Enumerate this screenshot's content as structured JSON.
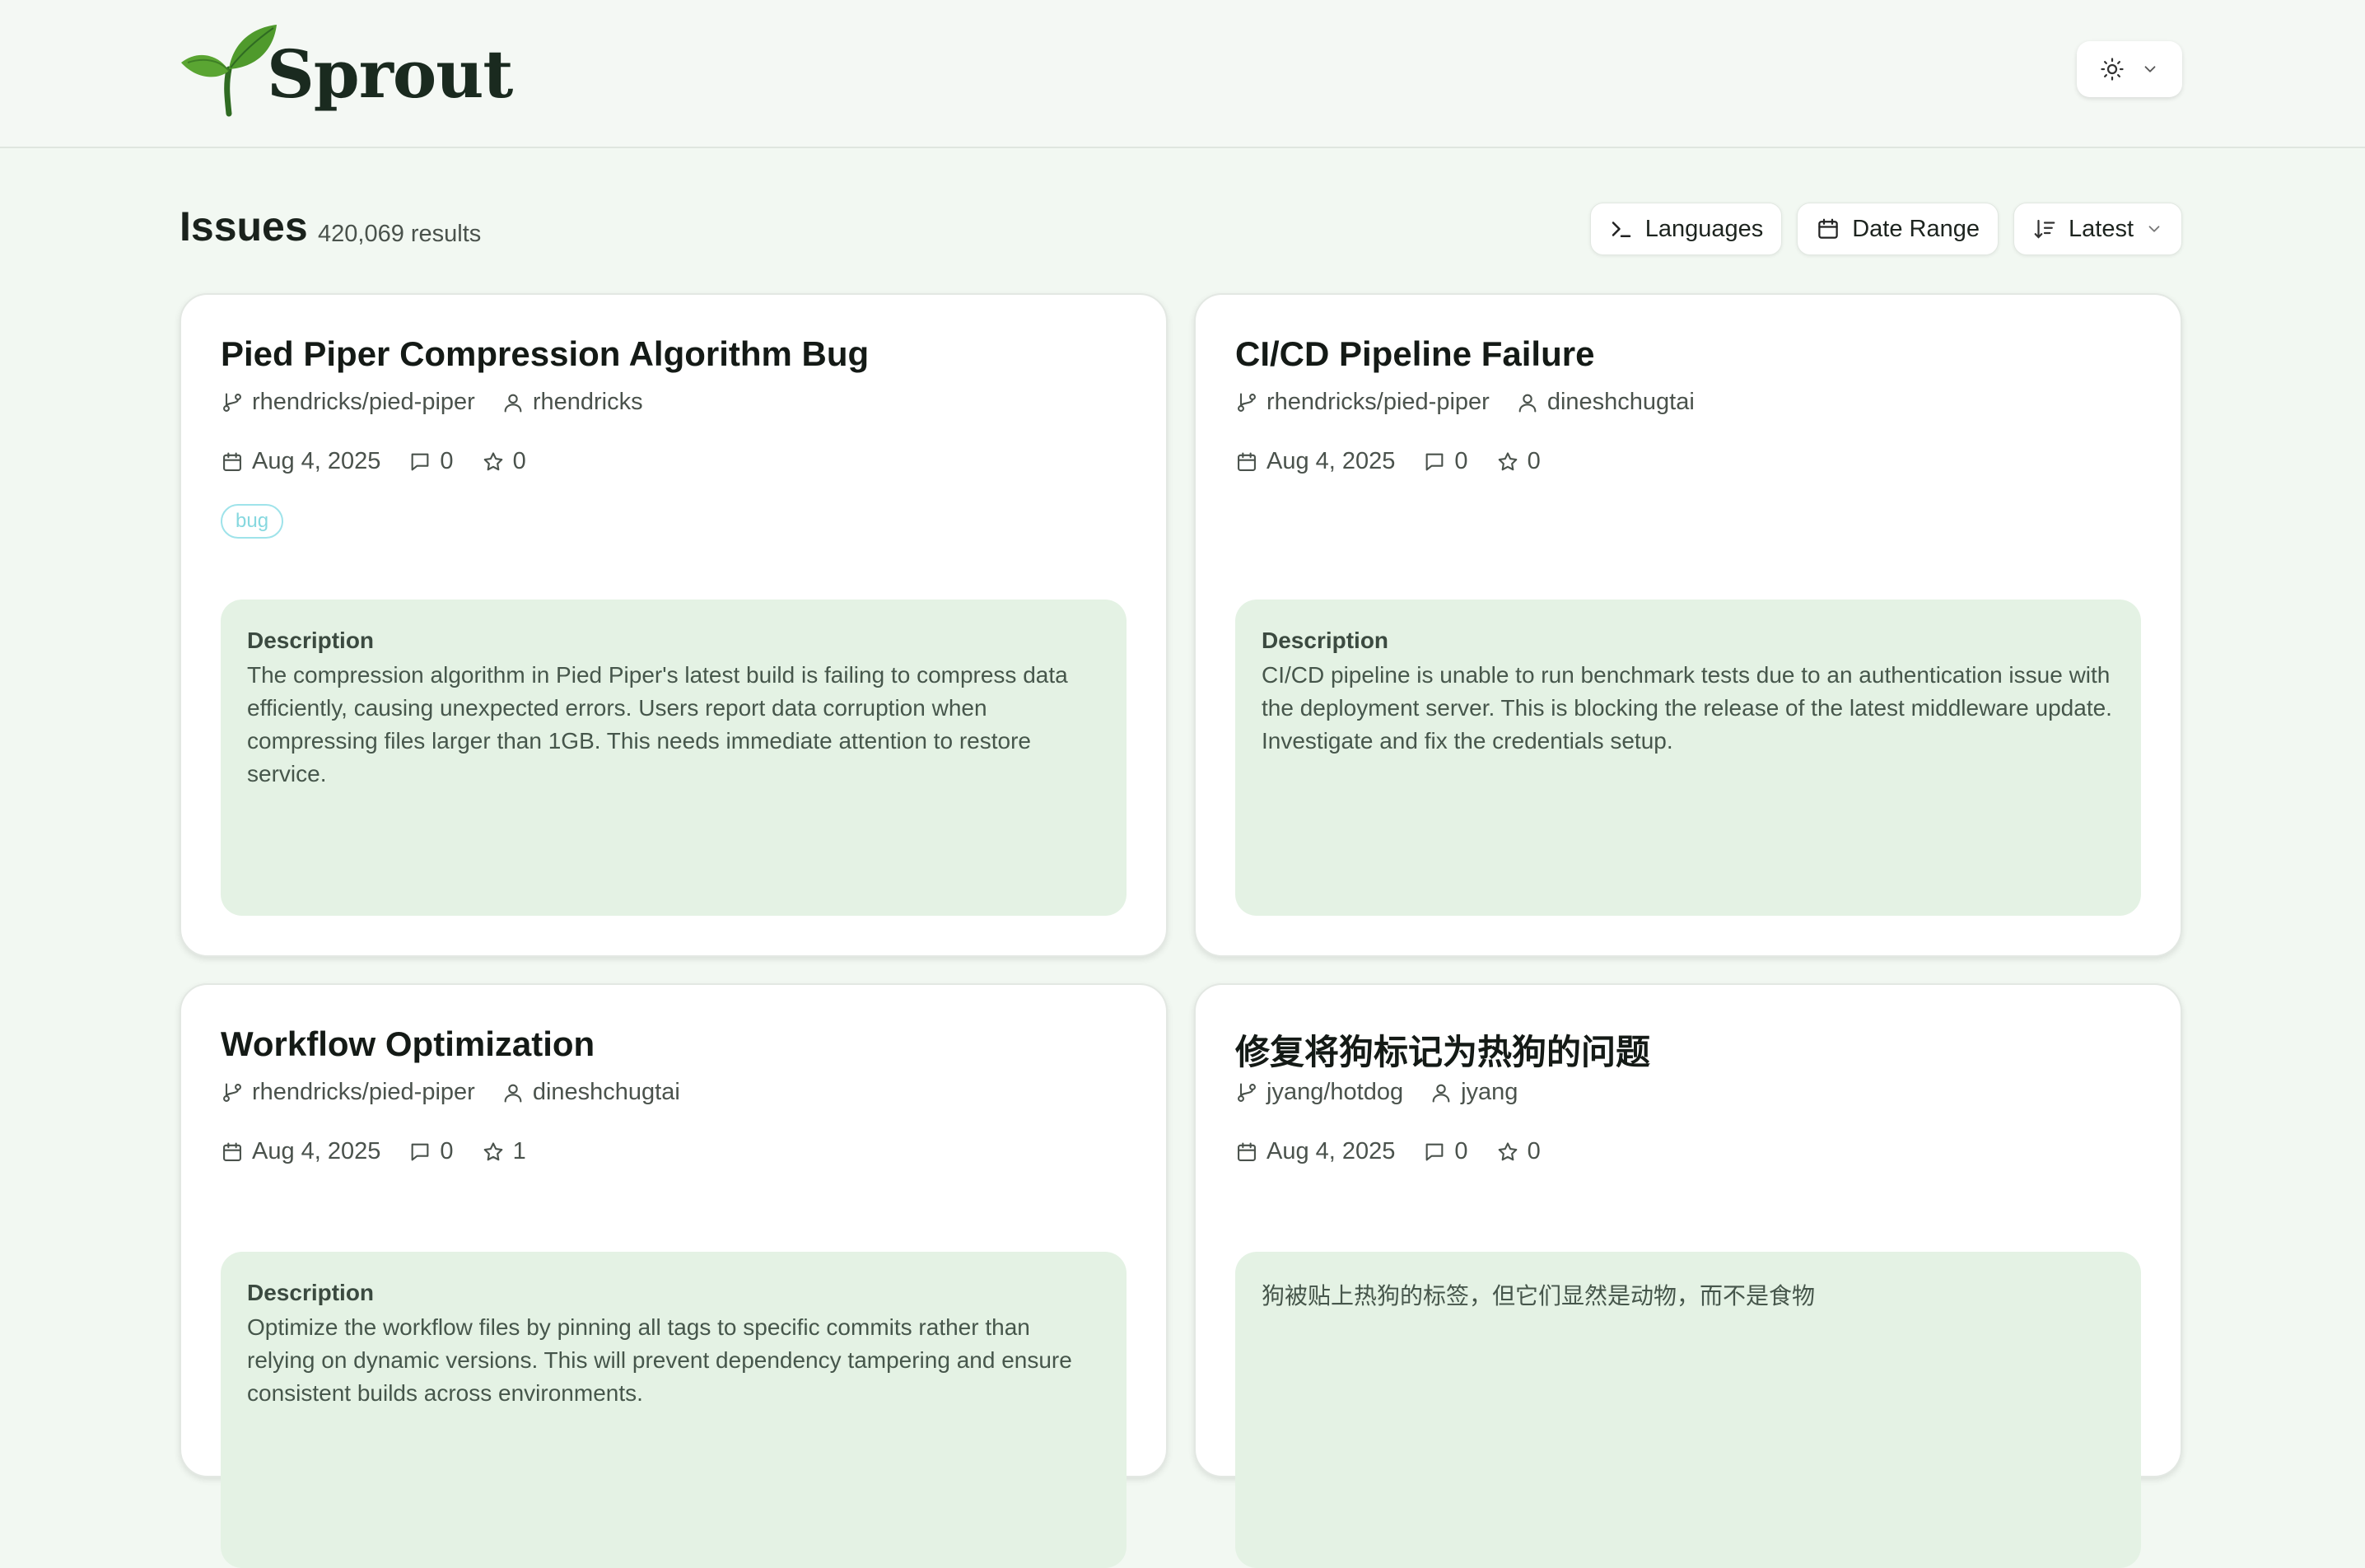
{
  "app": {
    "logo_text": "Sprout"
  },
  "header": {
    "theme_toggle": {
      "icon": "sun-icon",
      "chevron": "chevron-down-icon"
    }
  },
  "toolbar": {
    "title": "Issues",
    "result_count": "420,069 results",
    "filters": {
      "languages": "Languages",
      "date_range": "Date Range",
      "sort": "Latest"
    }
  },
  "issues": [
    {
      "title": "Pied Piper Compression Algorithm Bug",
      "repo": "rhendricks/pied-piper",
      "author": "rhendricks",
      "date": "Aug 4, 2025",
      "comments": "0",
      "stars": "0",
      "tag": "bug",
      "description_label": "Description",
      "description": "The compression algorithm in Pied Piper's latest build is failing to compress data efficiently, causing unexpected errors. Users report data corruption when compressing files larger than 1GB. This needs immediate attention to restore service."
    },
    {
      "title": "CI/CD Pipeline Failure",
      "repo": "rhendricks/pied-piper",
      "author": "dineshchugtai",
      "date": "Aug 4, 2025",
      "comments": "0",
      "stars": "0",
      "description_label": "Description",
      "description": "CI/CD pipeline is unable to run benchmark tests due to an authentication issue with the deployment server. This is blocking the release of the latest middleware update. Investigate and fix the credentials setup."
    },
    {
      "title": "Workflow Optimization",
      "repo": "rhendricks/pied-piper",
      "author": "dineshchugtai",
      "date": "Aug 4, 2025",
      "comments": "0",
      "stars": "1",
      "description_label": "Description",
      "description": "Optimize the workflow files by pinning all tags to specific commits rather than relying on dynamic versions. This will prevent dependency tampering and ensure consistent builds across environments."
    },
    {
      "title": "修复将狗标记为热狗的问题",
      "repo": "jyang/hotdog",
      "author": "jyang",
      "date": "Aug 4, 2025",
      "comments": "0",
      "stars": "0",
      "description": "狗被贴上热狗的标签，但它们显然是动物，而不是食物"
    }
  ],
  "colors": {
    "background": "#f2f8f2",
    "card": "#ffffff",
    "description_bg": "#e4f2e4",
    "tag_border": "#9fe3ea",
    "brand_leaf": "#5aa532"
  }
}
